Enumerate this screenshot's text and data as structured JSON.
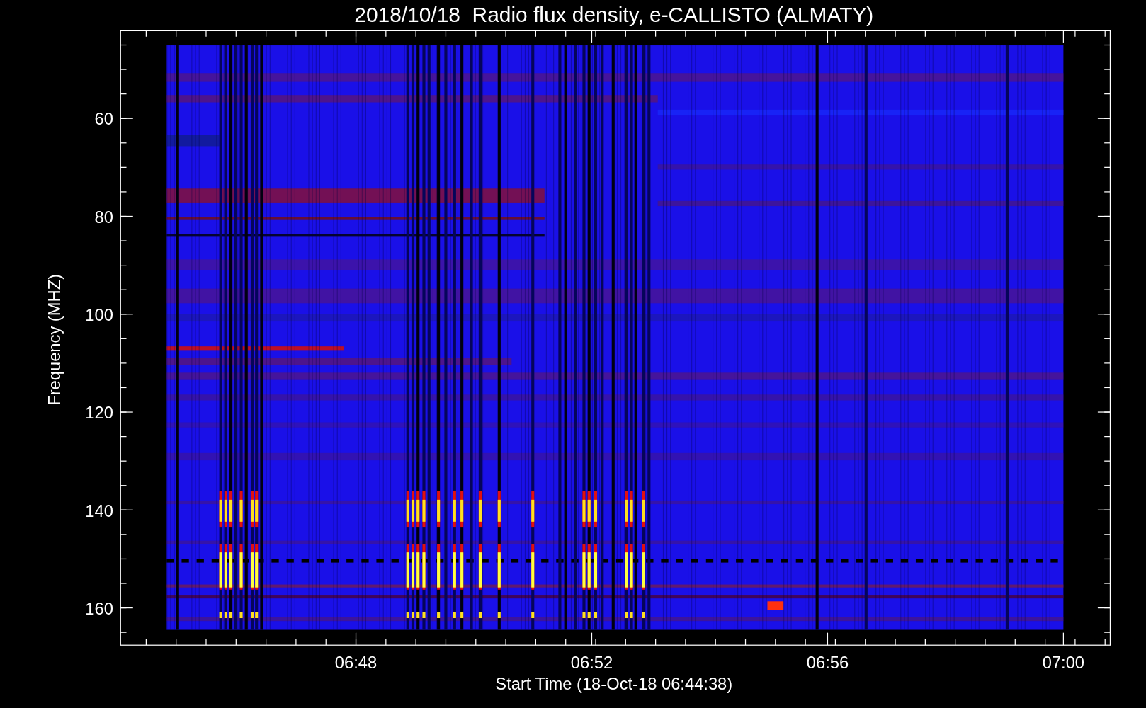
{
  "plot": {
    "title": "2018/10/18  Radio flux density, e-CALLISTO (ALMATY)",
    "ylabel": "Frequency (MHZ)",
    "xlabel": "Start Time (18-Oct-18 06:44:38)",
    "yticks": [
      "60",
      "80",
      "100",
      "120",
      "140",
      "160"
    ],
    "xticks": [
      "06:48",
      "06:52",
      "06:56",
      "07:00"
    ]
  }
}
